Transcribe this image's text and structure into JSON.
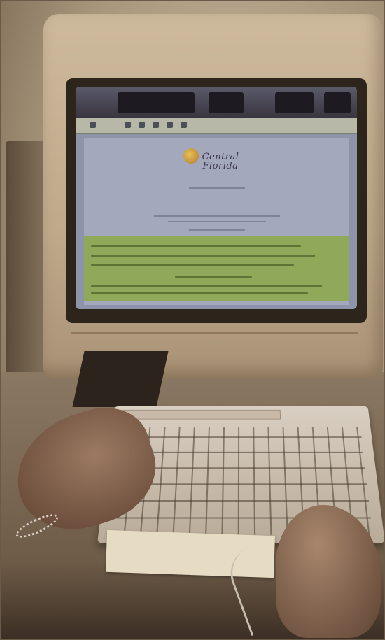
{
  "photo": {
    "subject": "",
    "screen_logo_text": "Central Florida",
    "screen_page_heading": ""
  },
  "colors": {
    "screen_bg": "#8d93a8",
    "screen_green_panel": "#8fa85a",
    "monitor_beige": "#cdb99c",
    "desk_brown": "#6e5c48"
  }
}
